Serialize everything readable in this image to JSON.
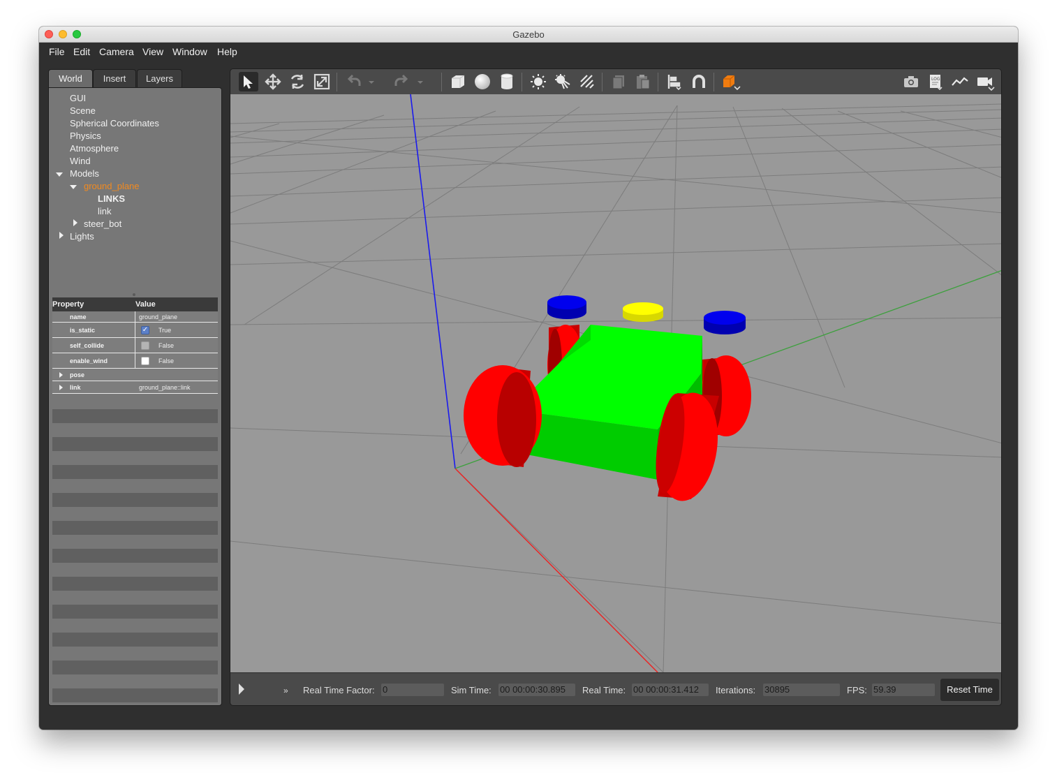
{
  "window": {
    "title": "Gazebo"
  },
  "menu": [
    "File",
    "Edit",
    "Camera",
    "View",
    "Window",
    "Help"
  ],
  "left_panel": {
    "tabs": [
      "World",
      "Insert",
      "Layers"
    ],
    "active_tab": "World",
    "tree": {
      "gui": "GUI",
      "scene": "Scene",
      "spherical_coordinates": "Spherical Coordinates",
      "physics": "Physics",
      "atmosphere": "Atmosphere",
      "wind": "Wind",
      "models": "Models",
      "ground_plane": "ground_plane",
      "links_header": "LINKS",
      "link": "link",
      "steer_bot": "steer_bot",
      "lights": "Lights"
    },
    "properties": {
      "header_property": "Property",
      "header_value": "Value",
      "rows": {
        "name": {
          "key": "name",
          "value": "ground_plane"
        },
        "is_static": {
          "key": "is_static",
          "value": "True",
          "checked": true
        },
        "self_collide": {
          "key": "self_collide",
          "value": "False",
          "checked": false
        },
        "enable_wind": {
          "key": "enable_wind",
          "value": "False",
          "checked": false
        },
        "pose": {
          "key": "pose",
          "value": ""
        },
        "link": {
          "key": "link",
          "value": "ground_plane::link"
        }
      }
    }
  },
  "toolbar": {
    "icons": [
      "select-mode-icon",
      "translate-mode-icon",
      "rotate-mode-icon",
      "scale-mode-icon",
      "undo-icon",
      "undo-history-icon",
      "redo-icon",
      "redo-history-icon",
      "box-shape-icon",
      "sphere-shape-icon",
      "cylinder-shape-icon",
      "point-light-icon",
      "spot-light-icon",
      "directional-light-icon",
      "copy-icon",
      "paste-icon",
      "align-icon",
      "snap-icon",
      "view-angle-icon",
      "screenshot-icon",
      "log-icon",
      "plot-icon",
      "video-record-icon"
    ]
  },
  "scene": {
    "model": "steer_bot",
    "colors": {
      "chassis": "#00ee00",
      "wheels": "#ff0000",
      "steer_caps": "#0000ee",
      "sensor": "#ffff00",
      "background": "#999999"
    }
  },
  "status": {
    "real_time_factor_label": "Real Time Factor:",
    "real_time_factor": "0",
    "sim_time_label": "Sim Time:",
    "sim_time": "00 00:00:30.895",
    "real_time_label": "Real Time:",
    "real_time": "00 00:00:31.412",
    "iterations_label": "Iterations:",
    "iterations": "30895",
    "fps_label": "FPS:",
    "fps": "59.39",
    "reset_time": "Reset Time",
    "step_symbol": "»"
  }
}
